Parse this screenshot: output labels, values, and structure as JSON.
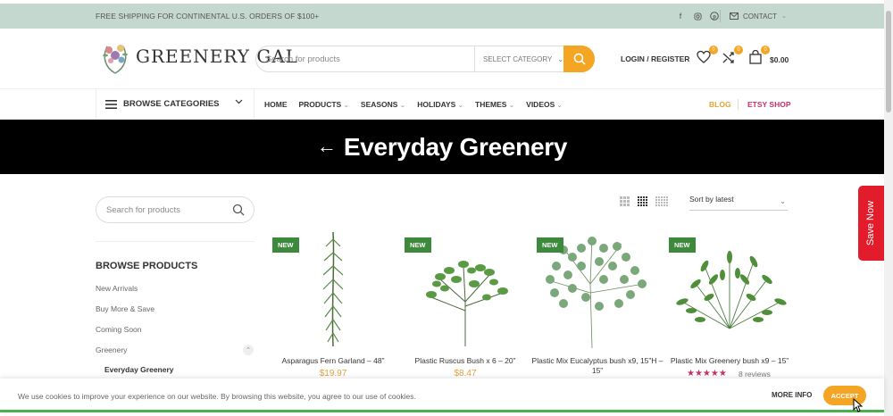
{
  "topbar": {
    "shipping": "FREE SHIPPING FOR CONTINENTAL U.S. ORDERS OF $100+",
    "contact": "CONTACT"
  },
  "header": {
    "logo_text": "GREENERY GAL",
    "search_placeholder": "Search for products",
    "category": "SELECT CATEGORY",
    "login": "LOGIN / REGISTER",
    "wishlist_count": "0",
    "compare_count": "0",
    "cart_count": "0",
    "cart_total": "$0.00"
  },
  "nav": {
    "browse": "BROWSE CATEGORIES",
    "items": [
      "HOME",
      "PRODUCTS",
      "SEASONS",
      "HOLIDAYS",
      "THEMES",
      "VIDEOS"
    ],
    "blog": "BLOG",
    "etsy": "ETSY SHOP"
  },
  "banner": {
    "title": "Everyday Greenery"
  },
  "sidebar": {
    "search_placeholder": "Search for products",
    "title": "BROWSE PRODUCTS",
    "items": [
      "New Arrivals",
      "Buy More & Save",
      "Coming Soon",
      "Greenery",
      "Everyday Greenery"
    ]
  },
  "toolbar": {
    "sort": "Sort by latest"
  },
  "products": [
    {
      "badge": "NEW",
      "name": "Asparagus Fern Garland – 48”",
      "price": "$19.97"
    },
    {
      "badge": "NEW",
      "name": "Plastic Ruscus Bush x 6 – 20”",
      "price": "$8.47"
    },
    {
      "badge": "NEW",
      "name": "Plastic Mix Eucalyptus bush x9, 15”H – 15”",
      "price": ""
    },
    {
      "badge": "NEW",
      "name": "Plastic Mix Greenery bush x9 – 15”",
      "stars": "★★★★★",
      "reviews": "8 reviews"
    }
  ],
  "savenow": "Save Now",
  "cookie": {
    "message": "We use cookies to improve your experience on our website. By browsing this website, you agree to our use of cookies.",
    "more": "MORE INFO",
    "accept": "ACCEPT"
  },
  "colors": {
    "accent": "#f3a523",
    "topbar": "#c5d8cf",
    "new_badge": "#3d8a3d",
    "save_now": "#e21c2a",
    "etsy": "#c0356b"
  }
}
